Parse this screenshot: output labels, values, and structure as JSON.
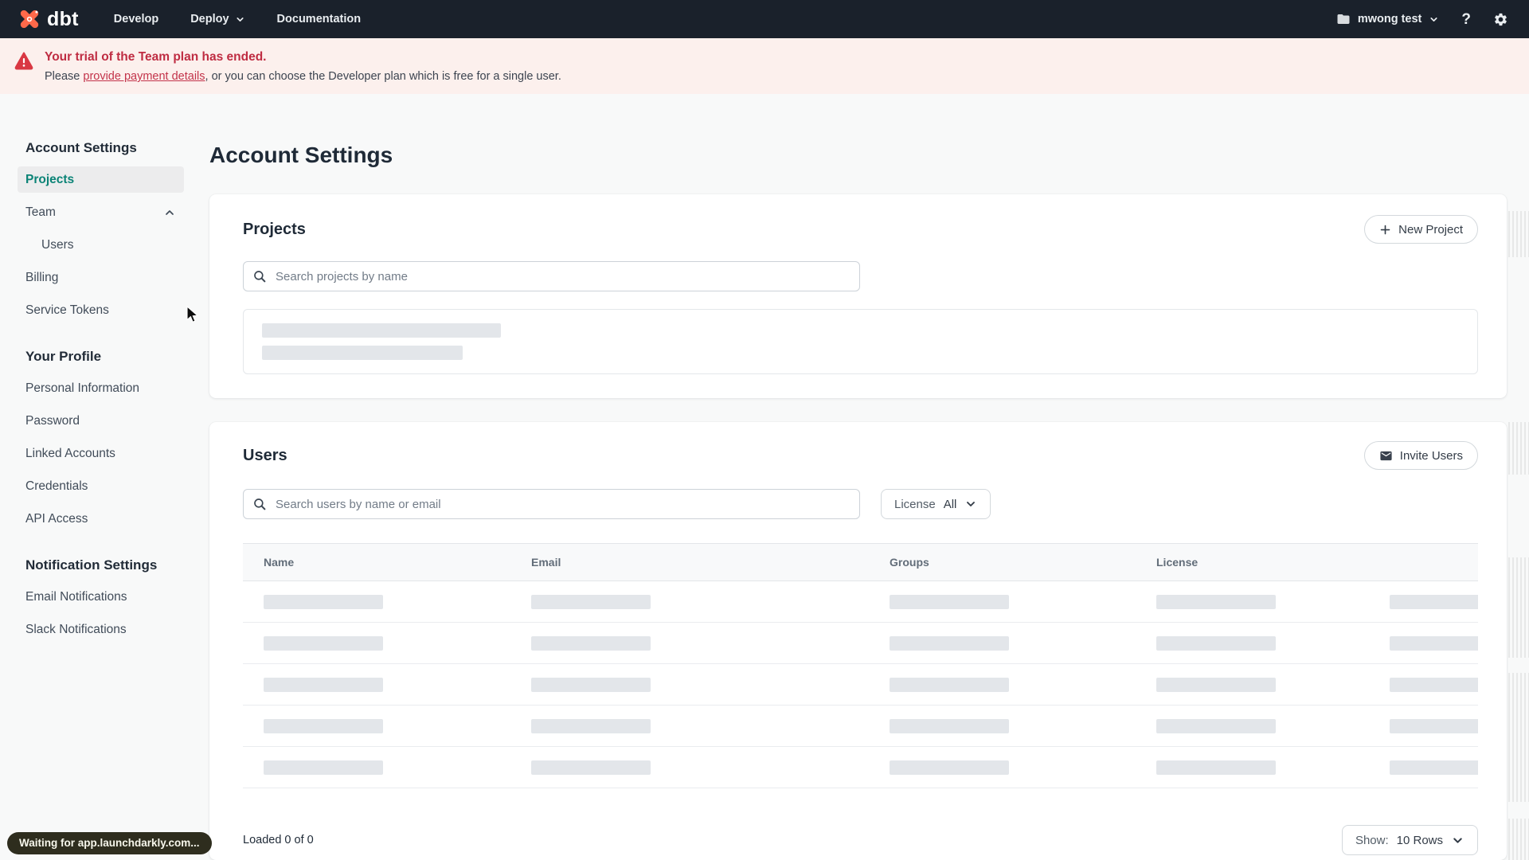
{
  "nav": {
    "logo_text": "dbt",
    "develop": "Develop",
    "deploy": "Deploy",
    "documentation": "Documentation",
    "account_label": "mwong test",
    "help_glyph": "?"
  },
  "banner": {
    "title": "Your trial of the Team plan has ended.",
    "body_prefix": "Please ",
    "link_text": "provide payment details",
    "body_suffix": ", or you can choose the Developer plan which is free for a single user."
  },
  "sidebar": {
    "sections": [
      {
        "heading": "Account Settings",
        "items": [
          {
            "label": "Projects"
          },
          {
            "label": "Team"
          },
          {
            "label": "Users"
          },
          {
            "label": "Billing"
          },
          {
            "label": "Service Tokens"
          }
        ]
      },
      {
        "heading": "Your Profile",
        "items": [
          {
            "label": "Personal Information"
          },
          {
            "label": "Password"
          },
          {
            "label": "Linked Accounts"
          },
          {
            "label": "Credentials"
          },
          {
            "label": "API Access"
          }
        ]
      },
      {
        "heading": "Notification Settings",
        "items": [
          {
            "label": "Email Notifications"
          },
          {
            "label": "Slack Notifications"
          }
        ]
      }
    ]
  },
  "main": {
    "page_title": "Account Settings",
    "projects": {
      "title": "Projects",
      "new_button": "New Project",
      "search_placeholder": "Search projects by name"
    },
    "users": {
      "title": "Users",
      "invite_button": "Invite Users",
      "search_placeholder": "Search users by name or email",
      "license_filter_label": "License",
      "license_filter_value": "All",
      "columns": [
        "Name",
        "Email",
        "Groups",
        "License"
      ],
      "skeleton_row_count": 5,
      "loaded_text": "Loaded 0 of 0",
      "show_label": "Show:",
      "show_value": "10 Rows"
    }
  },
  "status": {
    "text": "Waiting for app.launchdarkly.com..."
  },
  "colors": {
    "brand_orange": "#ff694a",
    "nav_bg": "#1a212b",
    "banner_bg": "#fcf0ed",
    "banner_red": "#bf2c42",
    "active_teal": "#0b8376",
    "skeleton_gray": "#e3e6ea"
  }
}
